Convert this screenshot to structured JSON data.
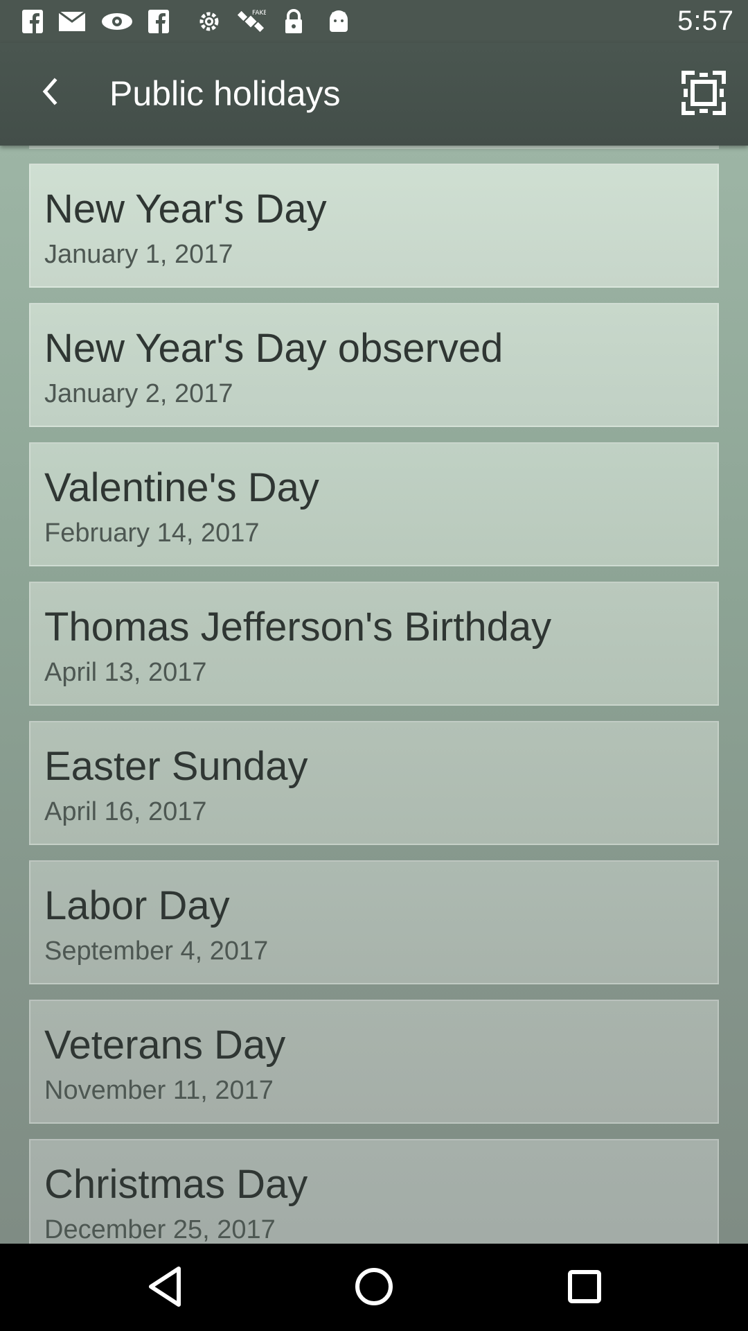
{
  "status_bar": {
    "time": "5:57",
    "notification_icons": [
      "facebook-icon",
      "mail-icon",
      "eye-icon",
      "facebook-icon",
      "settings-icon",
      "satellite-icon",
      "lock-icon",
      "android-icon"
    ]
  },
  "app_bar": {
    "title": "Public holidays",
    "back_icon": "chevron-left-icon",
    "action_icon": "fullscreen-frame-icon"
  },
  "holidays": [
    {
      "name": "New Year's Day",
      "date": "January 1, 2017"
    },
    {
      "name": "New Year's Day observed",
      "date": "January 2, 2017"
    },
    {
      "name": "Valentine's Day",
      "date": "February 14, 2017"
    },
    {
      "name": "Thomas Jefferson's Birthday",
      "date": "April 13, 2017"
    },
    {
      "name": "Easter Sunday",
      "date": "April 16, 2017"
    },
    {
      "name": "Labor Day",
      "date": "September 4, 2017"
    },
    {
      "name": "Veterans Day",
      "date": "November 11, 2017"
    },
    {
      "name": "Christmas Day",
      "date": "December 25, 2017"
    }
  ],
  "nav_bar": {
    "buttons": [
      "back-triangle-icon",
      "home-circle-icon",
      "recents-square-icon"
    ]
  },
  "colors": {
    "app_bar": "#47534d",
    "card_top": "#ccdccf",
    "card_bottom": "#a3aba5",
    "title_text": "#2f3633",
    "date_text": "#4d5752"
  }
}
